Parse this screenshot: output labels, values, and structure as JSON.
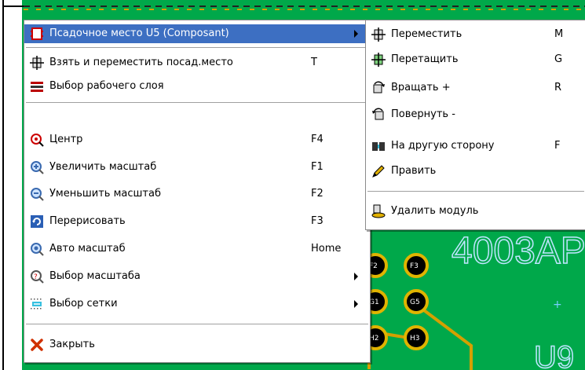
{
  "pcb": {
    "silk_text_1": "4003AP",
    "silk_text_2": "U9",
    "pad_labels": [
      "F2",
      "F3",
      "G1",
      "G5",
      "H2",
      "H3"
    ]
  },
  "context_menu": {
    "items": [
      {
        "label": "Псадочное место U5 (Composant)",
        "submenu": true,
        "icon": "footprint-icon"
      },
      {
        "label": "Взять и переместить посад.место",
        "key": "T",
        "icon": "move-footprint-icon"
      },
      {
        "label": "Выбор рабочего слоя",
        "icon": "layers-icon"
      },
      {
        "label": "Центр",
        "key": "F4",
        "icon": "center-icon"
      },
      {
        "label": "Увеличить масштаб",
        "key": "F1",
        "icon": "zoom-in-icon"
      },
      {
        "label": "Уменьшить масштаб",
        "key": "F2",
        "icon": "zoom-out-icon"
      },
      {
        "label": "Перерисовать",
        "key": "F3",
        "icon": "redraw-icon"
      },
      {
        "label": "Авто масштаб",
        "key": "Home",
        "icon": "zoom-auto-icon"
      },
      {
        "label": "Выбор масштаба",
        "submenu": true,
        "icon": "zoom-select-icon"
      },
      {
        "label": "Выбор сетки",
        "submenu": true,
        "icon": "grid-icon"
      },
      {
        "label": "Закрыть",
        "icon": "close-icon"
      }
    ]
  },
  "submenu": {
    "items": [
      {
        "label": "Переместить",
        "key": "M",
        "icon": "move-icon"
      },
      {
        "label": "Перетащить",
        "key": "G",
        "icon": "drag-icon"
      },
      {
        "label": "Вращать +",
        "key": "R",
        "icon": "rotate-cw-icon"
      },
      {
        "label": "Повернуть -",
        "key": "",
        "icon": "rotate-ccw-icon"
      },
      {
        "label": "На другую сторону",
        "key": "F",
        "icon": "flip-icon"
      },
      {
        "label": "Править",
        "key": "",
        "icon": "edit-icon"
      },
      {
        "label": "Удалить модуль",
        "key": "",
        "icon": "delete-module-icon"
      }
    ]
  },
  "colors": {
    "pcb_green": "#00a84a",
    "highlight": "#3d6fc2",
    "pad_yellow": "#e0b400"
  }
}
